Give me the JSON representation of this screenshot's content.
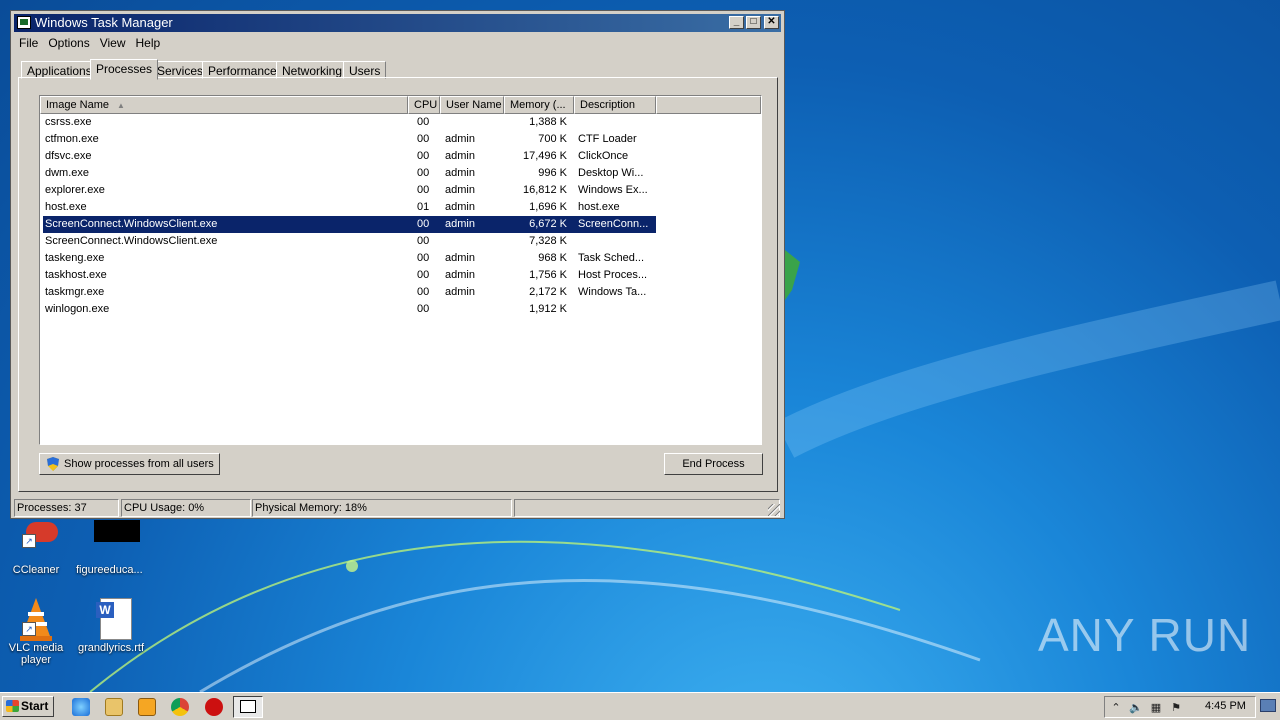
{
  "window": {
    "title": "Windows Task Manager",
    "controls": {
      "minimize": "_",
      "maximize": "□",
      "close": "✕"
    }
  },
  "menu": [
    "File",
    "Options",
    "View",
    "Help"
  ],
  "tabs": [
    "Applications",
    "Processes",
    "Services",
    "Performance",
    "Networking",
    "Users"
  ],
  "active_tab": "Processes",
  "columns": {
    "image_name": "Image Name",
    "cpu": "CPU",
    "user_name": "User Name",
    "memory": "Memory (...",
    "description": "Description"
  },
  "processes": [
    {
      "name": "csrss.exe",
      "cpu": "00",
      "user": "",
      "memory": "1,388 K",
      "desc": ""
    },
    {
      "name": "ctfmon.exe",
      "cpu": "00",
      "user": "admin",
      "memory": "700 K",
      "desc": "CTF Loader"
    },
    {
      "name": "dfsvc.exe",
      "cpu": "00",
      "user": "admin",
      "memory": "17,496 K",
      "desc": "ClickOnce"
    },
    {
      "name": "dwm.exe",
      "cpu": "00",
      "user": "admin",
      "memory": "996 K",
      "desc": "Desktop Wi..."
    },
    {
      "name": "explorer.exe",
      "cpu": "00",
      "user": "admin",
      "memory": "16,812 K",
      "desc": "Windows Ex..."
    },
    {
      "name": "host.exe",
      "cpu": "01",
      "user": "admin",
      "memory": "1,696 K",
      "desc": "host.exe"
    },
    {
      "name": "ScreenConnect.WindowsClient.exe",
      "cpu": "00",
      "user": "admin",
      "memory": "6,672 K",
      "desc": "ScreenConn..."
    },
    {
      "name": "ScreenConnect.WindowsClient.exe",
      "cpu": "00",
      "user": "",
      "memory": "7,328 K",
      "desc": ""
    },
    {
      "name": "taskeng.exe",
      "cpu": "00",
      "user": "admin",
      "memory": "968 K",
      "desc": "Task Sched..."
    },
    {
      "name": "taskhost.exe",
      "cpu": "00",
      "user": "admin",
      "memory": "1,756 K",
      "desc": "Host Proces..."
    },
    {
      "name": "taskmgr.exe",
      "cpu": "00",
      "user": "admin",
      "memory": "2,172 K",
      "desc": "Windows Ta..."
    },
    {
      "name": "winlogon.exe",
      "cpu": "00",
      "user": "",
      "memory": "1,912 K",
      "desc": ""
    }
  ],
  "buttons": {
    "show_all": "Show processes from all users",
    "end_process": "End Process"
  },
  "status": {
    "processes": "Processes: 37",
    "cpu": "CPU Usage: 0%",
    "memory": "Physical Memory: 18%"
  },
  "desktop_icons": {
    "ccleaner": "CCleaner",
    "figure": "figureeduca...",
    "vlc": "VLC media player",
    "grandly": "grandlyrics.rtf"
  },
  "taskbar": {
    "start": "Start",
    "clock": "4:45 PM"
  },
  "watermark": "ANY RUN",
  "colors": {
    "selection": "#0a246a",
    "titlebar": "#0a246a",
    "chrome": "#d4d0c8"
  }
}
